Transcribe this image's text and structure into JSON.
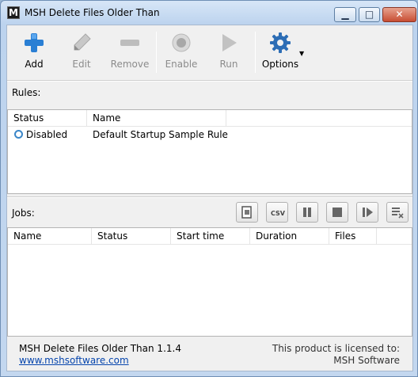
{
  "window": {
    "title": "MSH Delete Files Older Than",
    "icon_letter": "M",
    "controls": {
      "minimize": "▁",
      "maximize": "□",
      "close": "✕"
    }
  },
  "toolbar": {
    "buttons": [
      {
        "label": "Add",
        "icon": "add-plus-icon",
        "enabled": true
      },
      {
        "label": "Edit",
        "icon": "pencil-icon",
        "enabled": false
      },
      {
        "label": "Remove",
        "icon": "minus-icon",
        "enabled": false
      },
      {
        "label": "Enable",
        "icon": "circle-icon",
        "enabled": false
      },
      {
        "label": "Run",
        "icon": "play-icon",
        "enabled": false
      },
      {
        "label": "Options",
        "icon": "gear-icon",
        "enabled": true,
        "has_dropdown": true
      }
    ]
  },
  "rules": {
    "label": "Rules:",
    "columns": [
      "Status",
      "Name"
    ],
    "rows": [
      {
        "status": "Disabled",
        "name": "Default Startup Sample Rule"
      }
    ]
  },
  "jobs": {
    "label": "Jobs:",
    "action_buttons": [
      {
        "icon": "clear-icon"
      },
      {
        "icon": "csv-icon",
        "text": "CSV"
      },
      {
        "icon": "pause-icon"
      },
      {
        "icon": "stop-icon"
      },
      {
        "icon": "resume-icon"
      },
      {
        "icon": "list-delete-icon"
      }
    ],
    "columns": [
      "Name",
      "Status",
      "Start time",
      "Duration",
      "Files"
    ],
    "rows": []
  },
  "footer": {
    "product_version": "MSH Delete Files Older Than 1.1.4",
    "website": "www.mshsoftware.com",
    "license_line1": "This product is licensed to:",
    "license_line2": "MSH Software"
  },
  "colors": {
    "accent_blue": "#2a7fd4",
    "gear_blue": "#2c6db5",
    "link": "#0645ad",
    "status_disabled_ring": "#3a86c8"
  }
}
